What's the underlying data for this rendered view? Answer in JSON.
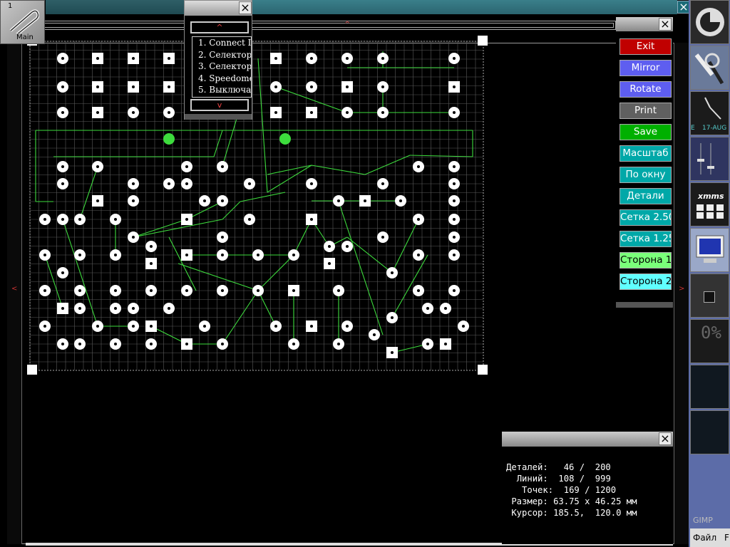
{
  "main_icon": {
    "number": "1",
    "label": "Main",
    "icon": "paperclip-icon"
  },
  "list_window": {
    "scroll_up": "^",
    "scroll_down": "v",
    "items": [
      "1. Connect I",
      "2. Селектор",
      "3. Селектор",
      "4. Speedome",
      "5. Выключат"
    ]
  },
  "ruler_arrows": {
    "top": "^",
    "left": "<",
    "right": ">"
  },
  "tool_panel": {
    "buttons": [
      {
        "label": "Exit",
        "bg": "#c00000",
        "fg": "#ffffff"
      },
      {
        "label": "Mirror",
        "bg": "#5e5ef0",
        "fg": "#ffffff"
      },
      {
        "label": "Rotate",
        "bg": "#5e5ef0",
        "fg": "#ffffff"
      },
      {
        "label": "Print",
        "bg": "#606060",
        "fg": "#ffffff"
      },
      {
        "label": "Save",
        "bg": "#00b000",
        "fg": "#ffffff"
      },
      {
        "label": "Масштаб",
        "bg": "#00a8a8",
        "fg": "#ffffff"
      },
      {
        "label": "По окну",
        "bg": "#00a8a8",
        "fg": "#ffffff"
      },
      {
        "label": "Детали",
        "bg": "#00a8a8",
        "fg": "#ffffff"
      },
      {
        "label": "Сетка 2.50",
        "bg": "#00a8a8",
        "fg": "#ffffff"
      },
      {
        "label": "Сетка 1.25",
        "bg": "#00a8a8",
        "fg": "#ffffff"
      },
      {
        "label": "Сторона 1",
        "bg": "#7aff7a",
        "fg": "#000000"
      },
      {
        "label": "Сторона 2",
        "bg": "#60ffff",
        "fg": "#000000"
      }
    ]
  },
  "stats": {
    "details_label": "Деталей:",
    "details_value": "46 /  200",
    "lines_label": "Линий:",
    "lines_value": "108 /  999",
    "points_label": "Точек:",
    "points_value": "169 / 1200",
    "size_label": "Размер:",
    "size_value": "63.75 x 46.25 мм",
    "cursor_label": "Курсор:",
    "cursor_value": "185.5,  120.0 мм"
  },
  "dock": {
    "clock_date": "17-AUG",
    "clock_day": "E",
    "xmms_label": "xmms",
    "cpu_percent": "0%",
    "taskbar_items": [
      "Файл",
      "F"
    ],
    "gimp_label": "GIMP"
  },
  "colors": {
    "grid": "#5a5a5a",
    "trace": "#3ddc3d",
    "pad": "#ffffff",
    "accent": "#1c6b78"
  }
}
